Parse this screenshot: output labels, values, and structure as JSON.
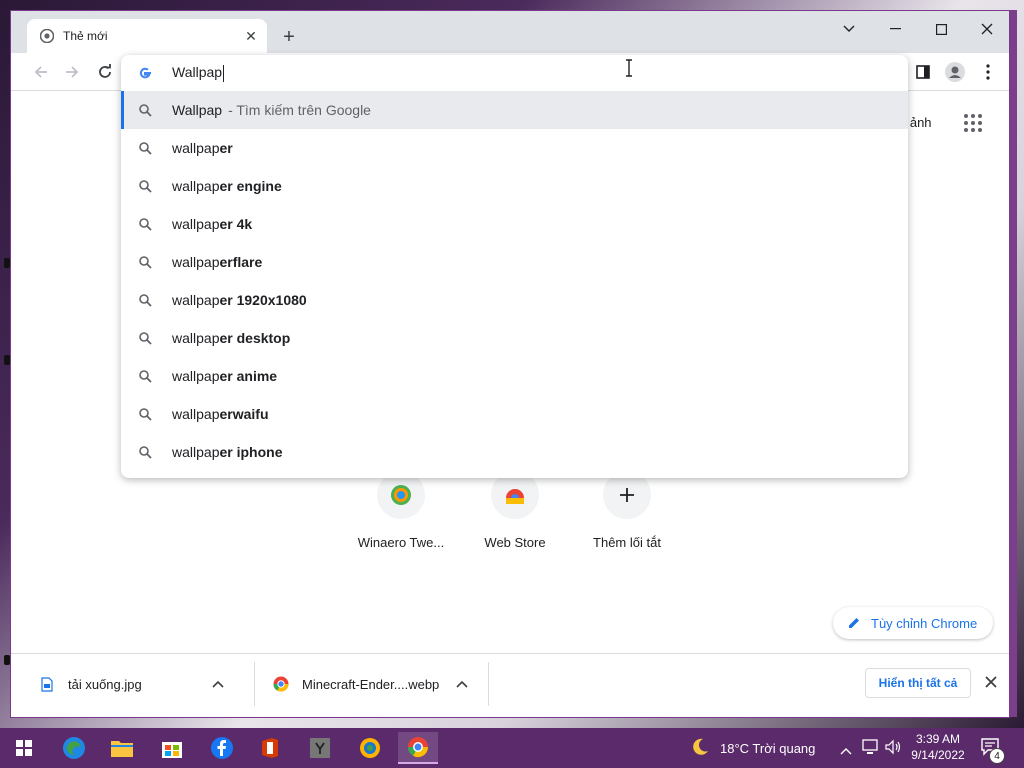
{
  "tab": {
    "title": "Thẻ mới",
    "close_glyph": "✕"
  },
  "window_controls": {
    "down": "⌄",
    "minimize": "—",
    "maximize": "☐",
    "close": "✕"
  },
  "omnibox": {
    "query": "Wallpap",
    "suggestions": [
      {
        "typed": "Wallpap",
        "rest": "",
        "hint": "- Tìm kiếm trên Google",
        "selected": true
      },
      {
        "typed": "wallpap",
        "rest": "er",
        "hint": ""
      },
      {
        "typed": "wallpap",
        "rest": "er engine",
        "hint": ""
      },
      {
        "typed": "wallpap",
        "rest": "er 4k",
        "hint": ""
      },
      {
        "typed": "wallpap",
        "rest": "erflare",
        "hint": ""
      },
      {
        "typed": "wallpap",
        "rest": "er 1920x1080",
        "hint": ""
      },
      {
        "typed": "wallpap",
        "rest": "er desktop",
        "hint": ""
      },
      {
        "typed": "wallpap",
        "rest": "er anime",
        "hint": ""
      },
      {
        "typed": "wallpap",
        "rest": "erwaifu",
        "hint": ""
      },
      {
        "typed": "wallpap",
        "rest": "er iphone",
        "hint": ""
      }
    ]
  },
  "header": {
    "images_link_partial": "h ảnh"
  },
  "shortcuts": [
    {
      "label": "Winaero Twe..."
    },
    {
      "label": "Web Store"
    },
    {
      "label": "Thêm lối tắt"
    }
  ],
  "customize_button": "Tùy chỉnh Chrome",
  "downloads": {
    "items": [
      {
        "name": "tải xuống.jpg"
      },
      {
        "name": "Minecraft-Ender....webp"
      }
    ],
    "show_all": "Hiển thị tất cả"
  },
  "taskbar": {
    "weather": "18°C  Trời quang",
    "time": "3:39 AM",
    "date": "9/14/2022",
    "notification_count": "4"
  },
  "colors": {
    "accent": "#1a73e8",
    "taskbar": "#5a2a6a",
    "window_border": "#7b3e8b"
  }
}
